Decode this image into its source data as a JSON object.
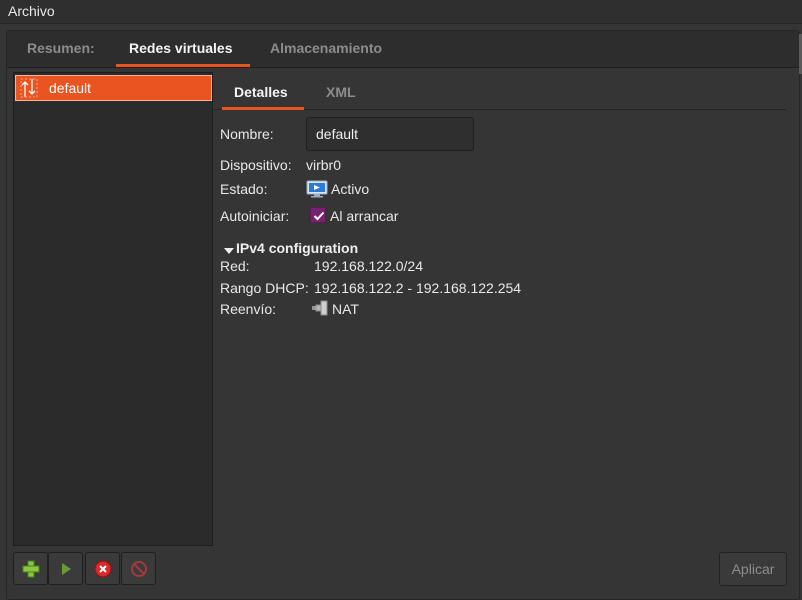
{
  "menubar": {
    "archivo": "Archivo"
  },
  "top_tabs": [
    {
      "label": "Resumen:"
    },
    {
      "label": "Redes virtuales"
    },
    {
      "label": "Almacenamiento"
    }
  ],
  "network_list": [
    {
      "name": "default",
      "icon": "network-icon"
    }
  ],
  "toolbar": {
    "add_icon": "plus-icon",
    "start_icon": "play-icon",
    "stop_icon": "stop-x-icon",
    "delete_icon": "no-entry-icon"
  },
  "apply_label": "Aplicar",
  "inner_tabs": [
    {
      "label": "Detalles"
    },
    {
      "label": "XML"
    }
  ],
  "details": {
    "name_label": "Nombre:",
    "name_value": "default",
    "device_label": "Dispositivo:",
    "device_value": "virbr0",
    "state_label": "Estado:",
    "state_value": "Activo",
    "autostart_label": "Autoiniciar:",
    "autostart_value": "Al arrancar",
    "autostart_checked": true
  },
  "ipv4": {
    "section_title": "IPv4 configuration",
    "network_label": "Red:",
    "network_value": "192.168.122.0/24",
    "dhcp_label": "Rango DHCP:",
    "dhcp_value": "192.168.122.2 - 192.168.122.254",
    "forward_label": "Reenvío:",
    "forward_value": "NAT"
  },
  "colors": {
    "accent": "#e95420",
    "checkbox": "#77216f",
    "background": "#353535"
  }
}
